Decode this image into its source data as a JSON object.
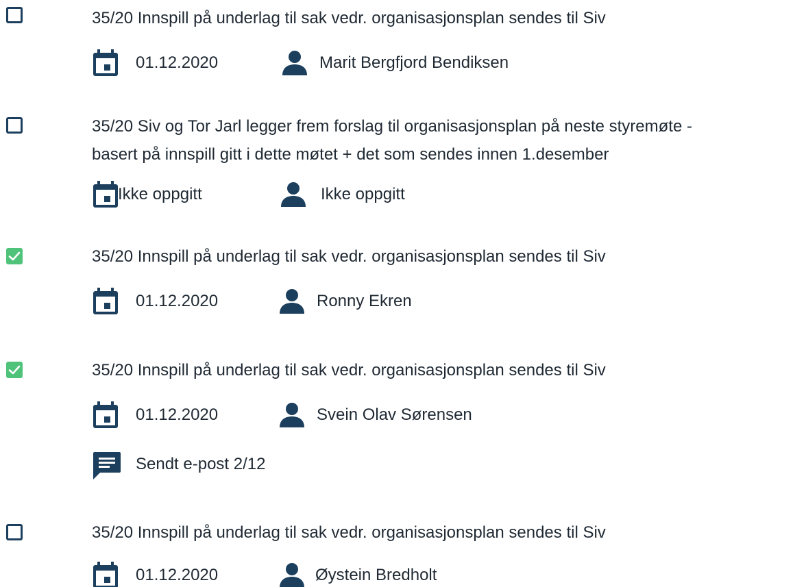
{
  "colors": {
    "icon": "#1c3f5e",
    "checked": "#4fc37a",
    "text": "#1f2933"
  },
  "tasks": [
    {
      "checked": false,
      "title_line1": "35/20  Innspill på underlag til sak vedr. organisasjonsplan sendes til Siv",
      "title_line2": "",
      "date": "01.12.2020",
      "assignee": "Marit Bergfjord Bendiksen"
    },
    {
      "checked": false,
      "title_line1": "35/20  Siv og Tor Jarl legger frem forslag til organisasjonsplan på neste styremøte -",
      "title_line2": "basert på innspill gitt i dette møtet + det som sendes innen 1.desember",
      "date": "Ikke oppgitt",
      "assignee": "Ikke oppgitt"
    },
    {
      "checked": true,
      "title_line1": "35/20 Innspill på underlag til sak vedr. organisasjonsplan sendes til Siv",
      "title_line2": "",
      "date": "01.12.2020",
      "assignee": "Ronny Ekren"
    },
    {
      "checked": true,
      "title_line1": "35/20 Innspill på underlag til sak vedr. organisasjonsplan sendes til Siv",
      "title_line2": "",
      "date": "01.12.2020",
      "assignee": "Svein Olav Sørensen",
      "comment": "Sendt e-post 2/12"
    },
    {
      "checked": false,
      "title_line1": "35/20 Innspill på underlag til sak vedr. organisasjonsplan sendes til Siv",
      "title_line2": "",
      "date": "01.12.2020",
      "assignee": "Øystein Bredholt"
    }
  ],
  "icons": {
    "checkbox_empty": "checkbox-unchecked-icon",
    "checkbox_checked": "checkbox-checked-icon",
    "date": "calendar-icon",
    "assignee": "person-icon",
    "comment": "comment-icon"
  }
}
